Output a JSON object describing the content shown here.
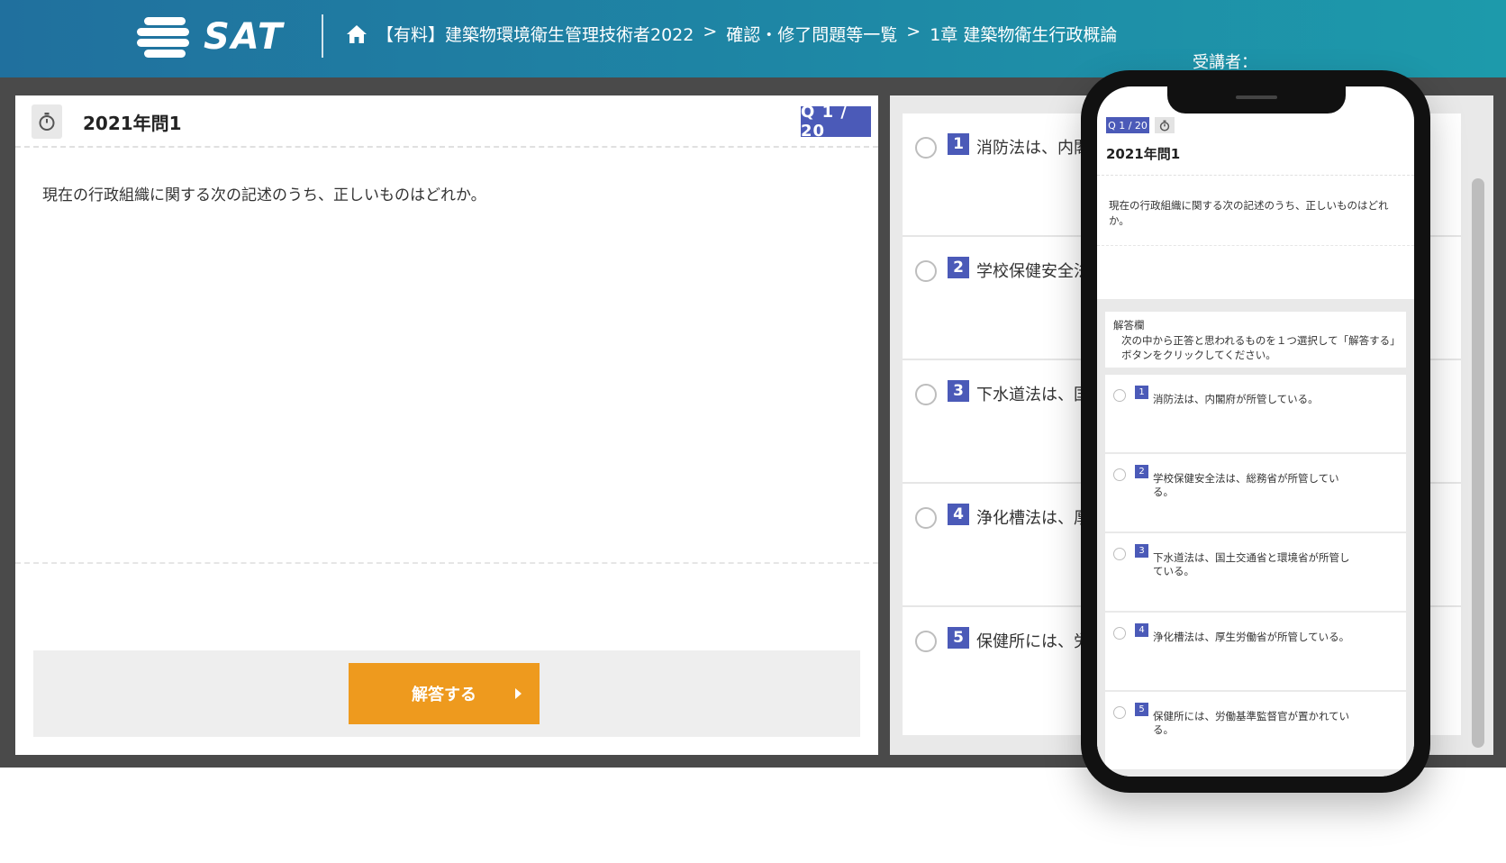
{
  "header": {
    "logo_text": "SAT",
    "breadcrumb": [
      "【有料】建築物環境衛生管理技術者2022",
      "確認・修了問題等一覧",
      "1章 建築物衛生行政概論"
    ],
    "separator": ">",
    "trainee_label": "受講者："
  },
  "question": {
    "title": "2021年問1",
    "counter": "Q 1 / 20",
    "text": "現在の行政組織に関する次の記述のうち、正しいものはどれか。",
    "submit_label": "解答する"
  },
  "options": [
    {
      "num": "1",
      "text": "消防法は、内閣府が所管している。",
      "visible": "消防法は、内閣"
    },
    {
      "num": "2",
      "text": "学校保健安全法は、総務省が所管している。",
      "visible": "学校保健安全法"
    },
    {
      "num": "3",
      "text": "下水道法は、国土交通省と環境省が所管している。",
      "visible": "下水道法は、国"
    },
    {
      "num": "4",
      "text": "浄化槽法は、厚生労働省が所管している。",
      "visible": "浄化槽法は、厚"
    },
    {
      "num": "5",
      "text": "保健所には、労働基準監督官が置かれている。",
      "visible": "保健所には、労"
    }
  ],
  "mobile": {
    "counter": "Q 1 / 20",
    "title": "2021年問1",
    "question_text": "現在の行政組織に関する次の記述のうち、正しいものはどれか。",
    "answer_label": "解答欄",
    "answer_instruction": "次の中から正答と思われるものを１つ選択して「解答する」ボタンをクリックしてください。",
    "options": [
      {
        "num": "1",
        "text": "消防法は、内閣府が所管している。"
      },
      {
        "num": "2",
        "text": "学校保健安全法は、総務省が所管している。"
      },
      {
        "num": "3",
        "text": "下水道法は、国土交通省と環境省が所管している。"
      },
      {
        "num": "4",
        "text": "浄化槽法は、厚生労働省が所管している。"
      },
      {
        "num": "5",
        "text": "保健所には、労働基準監督官が置かれている。"
      }
    ]
  },
  "colors": {
    "header": "#1e8aa6",
    "accent": "#4b5ab8",
    "button": "#ee9a1e"
  }
}
